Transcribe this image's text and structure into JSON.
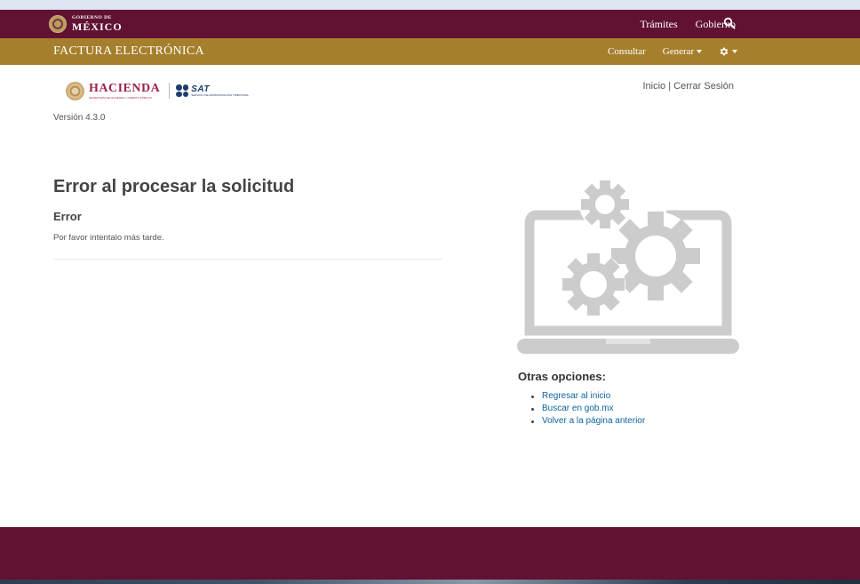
{
  "gob_header": {
    "logo_small": "GOBIERNO DE",
    "logo_big": "MÉXICO",
    "nav": [
      "Trámites",
      "Gobierno"
    ],
    "search_icon": "search-icon"
  },
  "factura_bar": {
    "title": "FACTURA ELECTRÓNICA",
    "consultar": "Consultar",
    "generar": "Generar",
    "settings_icon": "gear-icon"
  },
  "logos": {
    "hacienda": "HACIENDA",
    "hacienda_sub": "SECRETARÍA DE HACIENDA Y CRÉDITO PÚBLICO",
    "sat": "SAT",
    "sat_sub": "SERVICIO DE ADMINISTRACIÓN TRIBUTARIA"
  },
  "top_links": {
    "inicio": "Inicio",
    "separator": "|",
    "cerrar": "Cerrar Sesión"
  },
  "version": "Versión 4.3.0",
  "error": {
    "title": "Error al procesar la solicitud",
    "subtitle": "Error",
    "message": "Por favor intentalo más tarde."
  },
  "illustration_icon": "laptop-gears-icon",
  "options": {
    "title": "Otras opciones:",
    "items": [
      "Regresar al inicio",
      "Buscar en gob.mx",
      "Volver a la página anterior"
    ]
  },
  "colors": {
    "guinda": "#611232",
    "dorado": "#a57f2c",
    "link": "#0c64a0",
    "illustration": "#cccccc"
  }
}
